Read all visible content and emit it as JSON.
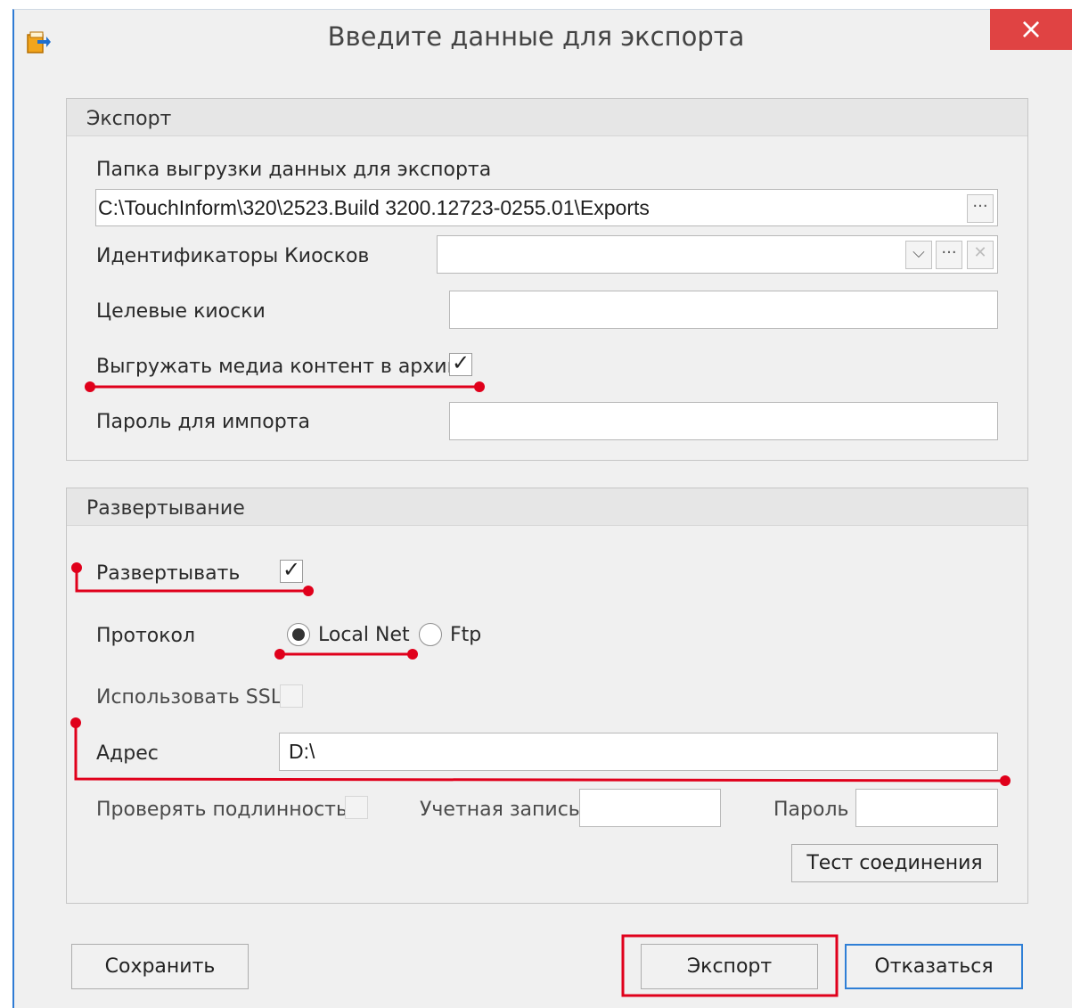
{
  "window": {
    "title": "Введите данные для экспорта",
    "close_glyph": "×"
  },
  "export_group": {
    "header": "Экспорт",
    "folder_label": "Папка выгрузки данных для экспорта",
    "folder_value": "C:\\TouchInform\\320\\2523.Build 3200.12723-0255.01\\Exports",
    "kiosk_ids_label": "Идентификаторы Киосков",
    "kiosk_ids_value": "",
    "target_kiosks_label": "Целевые киоски",
    "target_kiosks_value": "",
    "media_archive_label": "Выгружать медиа контент в архив",
    "media_archive_checked": true,
    "import_password_label": "Пароль для импорта",
    "import_password_value": ""
  },
  "deploy_group": {
    "header": "Развертывание",
    "deploy_label": "Развертывать",
    "deploy_checked": true,
    "protocol_label": "Протокол",
    "protocol_options": [
      "Local Net",
      "Ftp"
    ],
    "protocol_selected": "Local Net",
    "ssl_label": "Использовать SSL",
    "ssl_checked": false,
    "address_label": "Адрес",
    "address_value": "D:\\",
    "auth_label": "Проверять подлинность",
    "auth_checked": false,
    "account_label": "Учетная запись",
    "account_value": "",
    "password_label": "Пароль",
    "password_value": "",
    "test_button": "Тест соединения"
  },
  "footer": {
    "save_button": "Сохранить",
    "export_button": "Экспорт",
    "cancel_button": "Отказаться"
  },
  "glyphs": {
    "ellipsis": "···",
    "dropdown": "⌵",
    "clear": "✕",
    "check": "✓"
  },
  "colors": {
    "accent": "#2f7fd6",
    "close_bg": "#e04343",
    "annotation": "#e0001b"
  }
}
